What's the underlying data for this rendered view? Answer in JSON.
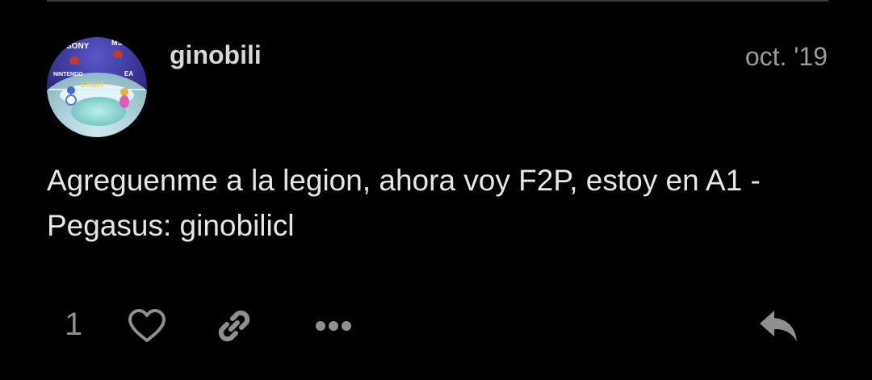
{
  "post": {
    "username": "ginobili",
    "date": "oct. '19",
    "body_lines": [
      "Agreguenme a la legion, ahora voy F2P, estoy en A1 -",
      "Pegasus: ginobilicl"
    ],
    "avatar_labels": [
      "SONY",
      "MS",
      "NINTENDO",
      "EA",
      "START"
    ]
  },
  "actions": {
    "like_count": "1",
    "icons": [
      "heart-icon",
      "link-icon",
      "more-icon",
      "reply-icon"
    ]
  },
  "colors": {
    "background": "#000000",
    "text": "#e6e6e6",
    "muted": "#8f8f8f",
    "divider": "#3a3a3a"
  }
}
